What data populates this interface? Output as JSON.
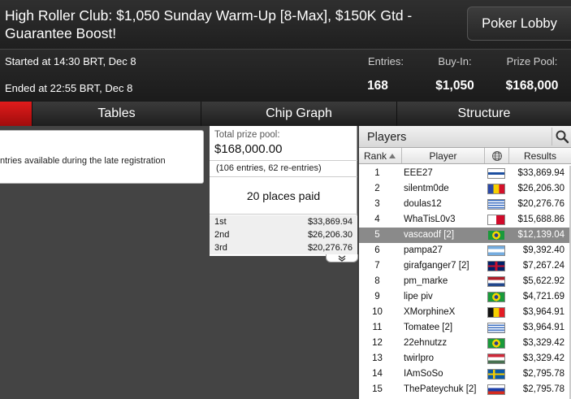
{
  "header": {
    "title": "High Roller Club: $1,050 Sunday Warm-Up [8-Max], $150K Gtd - Guarantee Boost!",
    "lobby_button": "Poker Lobby"
  },
  "info": {
    "started": "Started at 14:30 BRT, Dec 8",
    "ended": "Ended at 22:55 BRT, Dec 8",
    "stats": [
      {
        "label": "Entries:",
        "value": "168"
      },
      {
        "label": "Buy-In:",
        "value": "$1,050"
      },
      {
        "label": "Prize Pool:",
        "value": "$168,000"
      }
    ]
  },
  "tabs": [
    {
      "label": "",
      "active": true
    },
    {
      "label": "Tables"
    },
    {
      "label": "Chip Graph"
    },
    {
      "label": "Structure"
    }
  ],
  "left": {
    "note": "ntries available during the late registration"
  },
  "prize": {
    "label": "Total prize pool:",
    "amount": "$168,000.00",
    "entries": "(106 entries, 62 re-entries)",
    "places_paid": "20 places paid",
    "rows": [
      {
        "place": "1st",
        "amount": "$33,869.94"
      },
      {
        "place": "2nd",
        "amount": "$26,206.30"
      },
      {
        "place": "3rd",
        "amount": "$20,276.76"
      }
    ]
  },
  "players": {
    "title": "Players",
    "columns": {
      "rank": "Rank",
      "player": "Player",
      "results": "Results"
    },
    "selected_index": 4,
    "rows": [
      {
        "rank": "1",
        "name": "EEE27",
        "result": "$33,869.94",
        "flag": "finland"
      },
      {
        "rank": "2",
        "name": "silentm0de",
        "result": "$26,206.30",
        "flag": "moldova"
      },
      {
        "rank": "3",
        "name": "doulas12",
        "result": "$20,276.76",
        "flag": "greece"
      },
      {
        "rank": "4",
        "name": "WhaTisL0v3",
        "result": "$15,688.86",
        "flag": "malta"
      },
      {
        "rank": "5",
        "name": "vascaodf [2]",
        "result": "$12,139.04",
        "flag": "brazil"
      },
      {
        "rank": "6",
        "name": "pampa27",
        "result": "$9,392.40",
        "flag": "argentina"
      },
      {
        "rank": "7",
        "name": "girafganger7 [2]",
        "result": "$7,267.24",
        "flag": "united-kingdom"
      },
      {
        "rank": "8",
        "name": "pm_marke",
        "result": "$5,622.92",
        "flag": "netherlands"
      },
      {
        "rank": "9",
        "name": "lipe piv",
        "result": "$4,721.69",
        "flag": "brazil"
      },
      {
        "rank": "10",
        "name": "XMorphineX",
        "result": "$3,964.91",
        "flag": "belgium"
      },
      {
        "rank": "11",
        "name": "Tomatee [2]",
        "result": "$3,964.91",
        "flag": "uruguay"
      },
      {
        "rank": "12",
        "name": "22ehnutzz",
        "result": "$3,329.42",
        "flag": "brazil"
      },
      {
        "rank": "13",
        "name": "twirlpro",
        "result": "$3,329.42",
        "flag": "hungary"
      },
      {
        "rank": "14",
        "name": "IAmSoSo",
        "result": "$2,795.78",
        "flag": "sweden"
      },
      {
        "rank": "15",
        "name": "ThePateychuk [2]",
        "result": "$2,795.78",
        "flag": "russia"
      }
    ]
  },
  "colors": {
    "accent_red": "#d01515",
    "selected_row": "#8a8a8a"
  }
}
